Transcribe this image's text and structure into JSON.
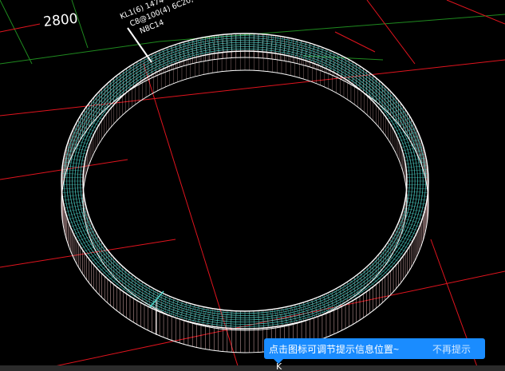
{
  "drawing": {
    "dimension_label": "2800",
    "annotation_lines": [
      "KL1(6) 1474",
      "C8@100(4) 6C20,",
      "N8C14"
    ]
  },
  "tooltip": {
    "message": "点击图标可调节提示信息位置~",
    "dismiss_label": "不再提示"
  },
  "status": {
    "cursor_glyph": "K"
  },
  "colors": {
    "background": "#000000",
    "axis_red": "#e0141e",
    "axis_green": "#1f8a1f",
    "ring_cyan": "#4fd6cc",
    "ring_pink": "#e6b8b8",
    "ring_white": "#ffffff",
    "tooltip_bg": "#1a8cff"
  }
}
